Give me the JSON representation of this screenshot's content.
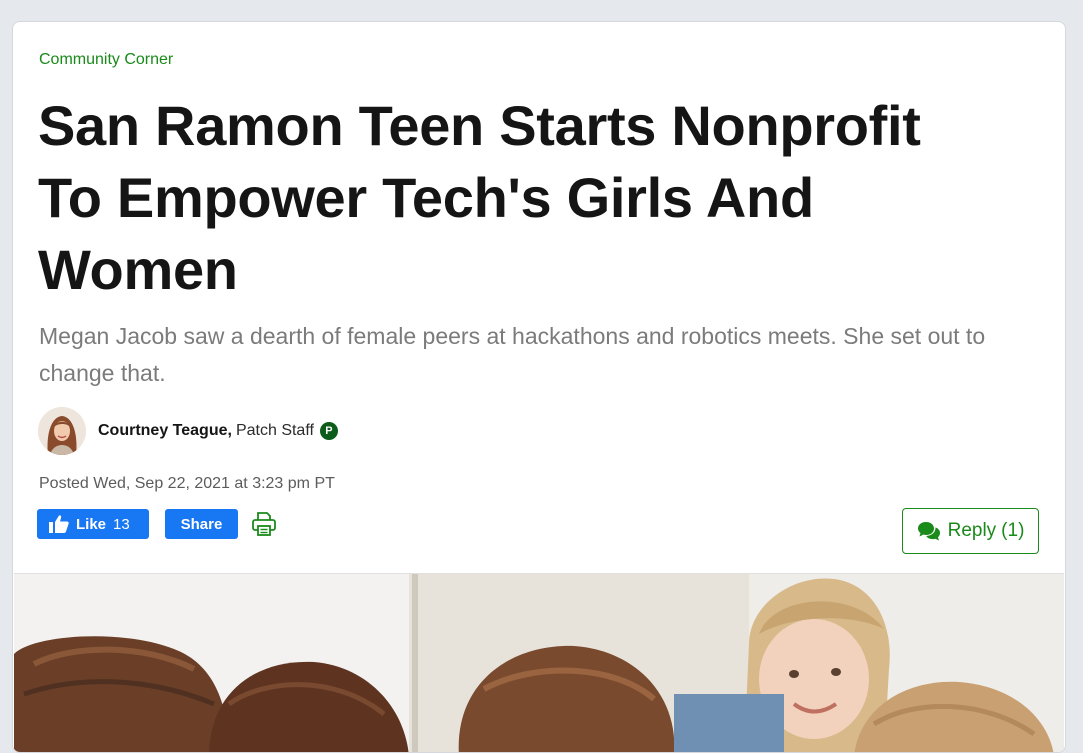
{
  "article": {
    "category": "Community Corner",
    "headline": "San Ramon Teen Starts Nonprofit To Empower Tech's Girls And Women",
    "dek": "Megan Jacob saw a dearth of female peers at hackathons and robotics meets. She set out to change that.",
    "author": {
      "name": "Courtney Teague,",
      "role": "Patch Staff",
      "badge": "P"
    },
    "posted": "Posted Wed, Sep 22, 2021 at 3:23 pm PT"
  },
  "actions": {
    "like_label": "Like",
    "like_count": "13",
    "share_label": "Share",
    "reply_label": "Reply",
    "reply_count": "(1)"
  },
  "colors": {
    "accent_green": "#1a8a1a",
    "facebook_blue": "#1877f2",
    "badge_green": "#0d5c19"
  },
  "icons": {
    "like": "thumbs-up-icon",
    "print": "printer-icon",
    "reply": "comments-icon"
  }
}
